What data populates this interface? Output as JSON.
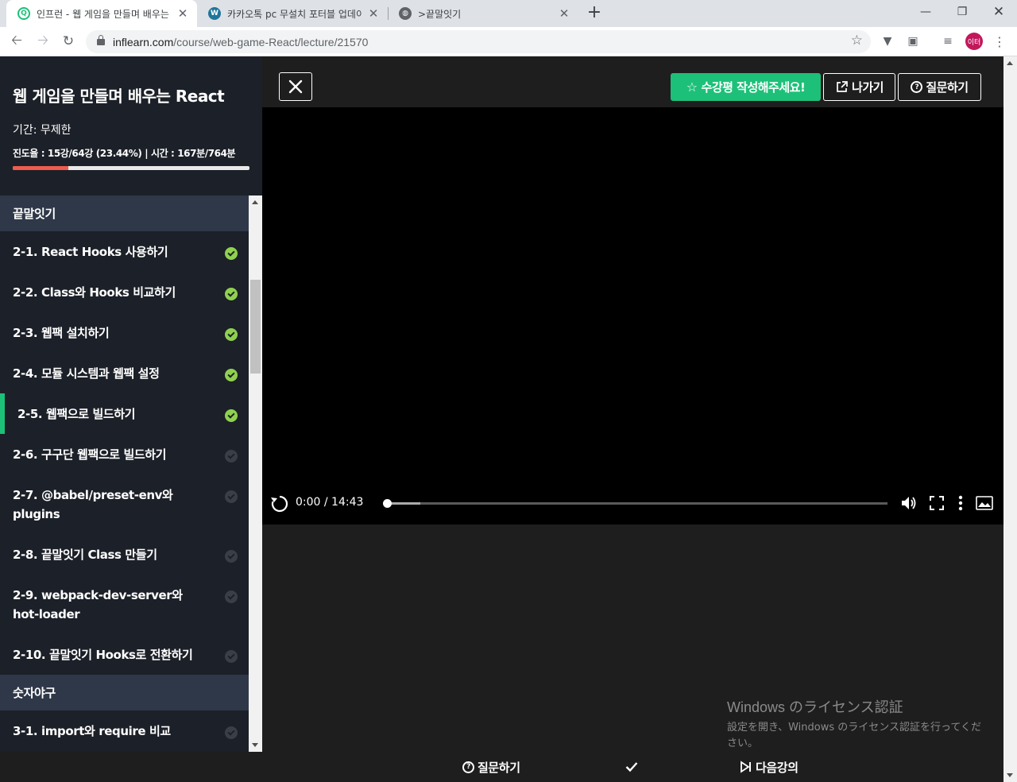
{
  "browser": {
    "tabs": [
      {
        "title": "인프런 - 웹 게임을 만들며 배우는",
        "active": true,
        "favicon": "inflearn-icon"
      },
      {
        "title": "카카오톡 pc 무설치 포터블 업데이",
        "active": false,
        "favicon": "wordpress-icon"
      },
      {
        "title": ">끝말잇기",
        "active": false,
        "favicon": "globe-icon"
      }
    ],
    "new_tab": "+",
    "url_host": "inflearn.com",
    "url_path": "/course/web-game-React/lecture/21570",
    "profile_initials": "이터"
  },
  "sidebar": {
    "course_title": "웹 게임을 만들며 배우는 React",
    "period": "기간: 무제한",
    "progress_text": "진도율 : 15강/64강 (23.44%) | 시간 : 167분/764분",
    "progress_percent": 23.44,
    "sections": [
      {
        "title": "끝말잇기",
        "lectures": [
          {
            "title": "2-1. React Hooks 사용하기",
            "done": true
          },
          {
            "title": "2-2. Class와 Hooks 비교하기",
            "done": true
          },
          {
            "title": "2-3. 웹팩 설치하기",
            "done": true
          },
          {
            "title": "2-4. 모듈 시스템과 웹팩 설정",
            "done": true
          },
          {
            "title": "2-5. 웹팩으로 빌드하기",
            "done": true,
            "current": true
          },
          {
            "title": "2-6. 구구단 웹팩으로 빌드하기",
            "done": false
          },
          {
            "title": "2-7. @babel/preset-env와 plugins",
            "done": false
          },
          {
            "title": "2-8. 끝말잇기 Class 만들기",
            "done": false
          },
          {
            "title": "2-9. webpack-dev-server와 hot-loader",
            "done": false
          },
          {
            "title": "2-10. 끝말잇기 Hooks로 전환하기",
            "done": false
          }
        ]
      },
      {
        "title": "숫자야구",
        "lectures": [
          {
            "title": "3-1. import와 require 비교",
            "done": false
          }
        ]
      }
    ]
  },
  "header": {
    "review_label": "수강평 작성해주세요!",
    "exit_label": "나가기",
    "question_label": "질문하기"
  },
  "player": {
    "time": "0:00 / 14:43",
    "played_fraction": 0.0,
    "buffered_fraction": 0.067
  },
  "watermark": {
    "title": "Windows のライセンス認証",
    "subtitle": "設定を開き、Windows のライセンス認証を行ってください。"
  },
  "bottom": {
    "question_label": "질문하기",
    "next_label": "다음강의"
  },
  "colors": {
    "accent": "#1dc078",
    "progress": "#ee5d4c",
    "done_check": "#8fd14f",
    "sidebar_bg": "#1c2028",
    "section_bg": "#2f3848"
  }
}
